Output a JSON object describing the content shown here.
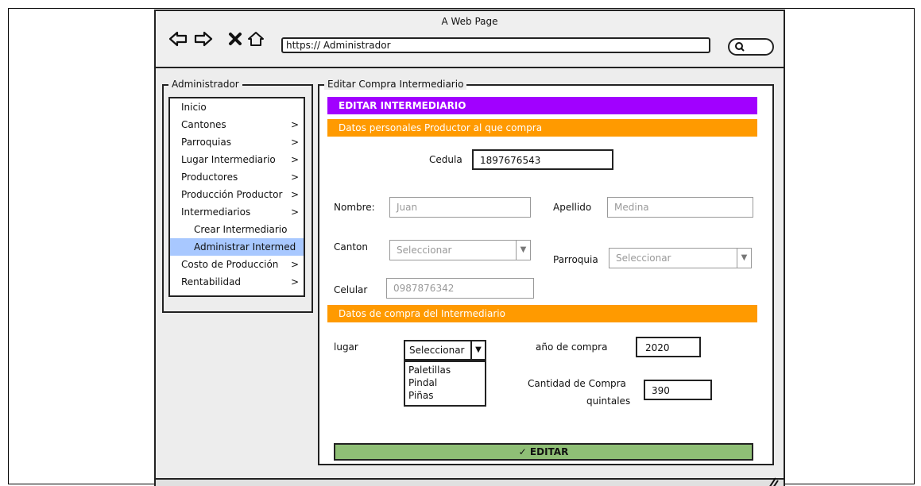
{
  "window": {
    "title": "A Web Page",
    "url": "https:// Administrador"
  },
  "sidebar": {
    "legend": "Administrador",
    "items": [
      {
        "label": "Inicio",
        "chevron": false
      },
      {
        "label": "Cantones",
        "chevron": true
      },
      {
        "label": "Parroquias",
        "chevron": true
      },
      {
        "label": "Lugar Intermediario",
        "chevron": true
      },
      {
        "label": "Productores",
        "chevron": true
      },
      {
        "label": "Producción Productor",
        "chevron": true
      },
      {
        "label": "Intermediarios",
        "chevron": true
      },
      {
        "label": "Crear Intermediario",
        "chevron": false
      },
      {
        "label": "Administrar Intermed",
        "chevron": false
      },
      {
        "label": "Costo de Producción",
        "chevron": true
      },
      {
        "label": "Rentabilidad",
        "chevron": true
      }
    ],
    "chevron_glyph": ">"
  },
  "main": {
    "legend": "Editar Compra Intermediario",
    "header": "EDITAR INTERMEDIARIO",
    "section_personal": "Datos personales Productor al que compra",
    "cedula_label": "Cedula",
    "cedula_value": "1897676543",
    "nombre_label": "Nombre:",
    "nombre_value": "Juan",
    "apellido_label": "Apellido",
    "apellido_value": "Medina",
    "canton_label": "Canton",
    "canton_value": "Seleccionar",
    "parroquia_label": "Parroquia",
    "parroquia_value": "Seleccionar",
    "celular_label": "Celular",
    "celular_value": "0987876342",
    "section_compra": "Datos de compra del Intermediario",
    "lugar_label": "lugar",
    "lugar_value": "Seleccionar",
    "lugar_options": [
      "Paletillas",
      "Pindal",
      "Piñas"
    ],
    "anio_label": "año de compra",
    "anio_value": "2020",
    "cantidad_label_1": "Cantidad de Compra",
    "cantidad_label_2": "quintales",
    "cantidad_value": "390",
    "edit_button": "EDITAR"
  },
  "colors": {
    "accent_purple": "#a100ff",
    "section_orange": "#ff9a00",
    "button_green": "#8fbf76",
    "active_item": "#a8c8ff"
  }
}
